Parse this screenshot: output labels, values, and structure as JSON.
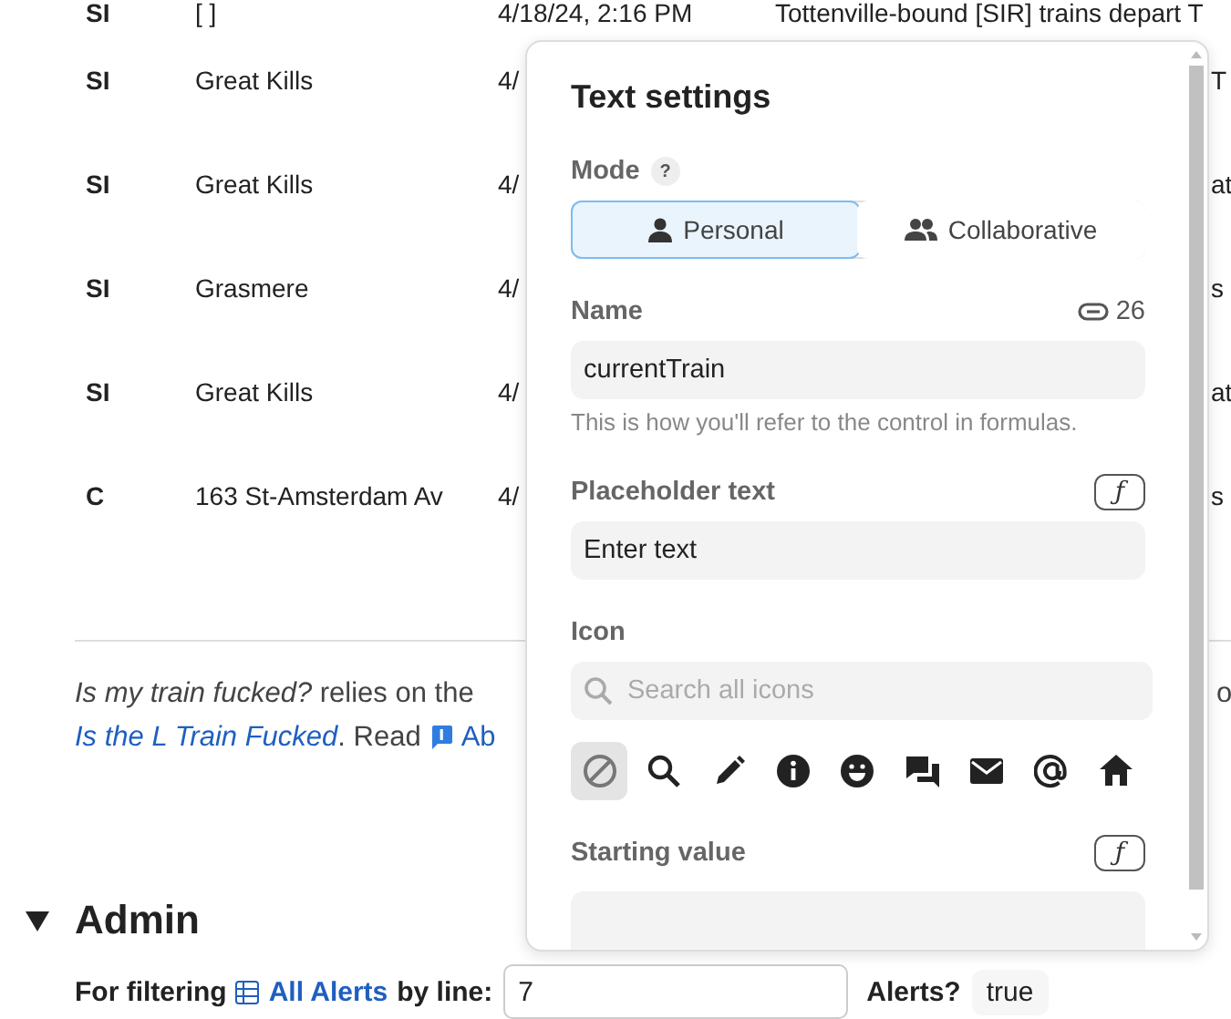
{
  "table": {
    "rows": [
      {
        "kind": "full",
        "line": "SI",
        "station": "[ ]",
        "date": "4/18/24, 2:16 PM",
        "message": "Tottenville-bound [SIR] trains depart T"
      },
      {
        "kind": "covered",
        "line": "SI",
        "station": "Great Kills",
        "date": "4/",
        "message": "T"
      },
      {
        "kind": "covered",
        "line": "SI",
        "station": "Great Kills",
        "date": "4/",
        "message": "at"
      },
      {
        "kind": "covered",
        "line": "SI",
        "station": "Grasmere",
        "date": "4/",
        "message": "s"
      },
      {
        "kind": "covered",
        "line": "SI",
        "station": "Great Kills",
        "date": "4/",
        "message": "at"
      },
      {
        "kind": "covered",
        "line": "C",
        "station": "163 St-Amsterdam Av",
        "date": "4/",
        "message": "s"
      }
    ]
  },
  "note": {
    "line_1": "*Is my train fucked?* relies on the",
    "line_1_tail": "o",
    "site_link": "Is the L Train Fucked",
    "read": ". Read",
    "about_link": "Ab"
  },
  "admin": {
    "expanded": true,
    "title": "Admin",
    "filter_label": "For filtering",
    "table_link": "All Alerts",
    "by_line": "by line:",
    "line_value": "7",
    "alerts_label": "Alerts?",
    "alerts_value": "true"
  },
  "panel": {
    "title": "Text settings",
    "mode": {
      "label": "Mode",
      "help": "?",
      "options": [
        {
          "label": "Personal",
          "selected": true
        },
        {
          "label": "Collaborative",
          "selected": false
        }
      ]
    },
    "name": {
      "label": "Name",
      "ref_count": "26",
      "value": "currentTrain",
      "hint": "This is how you'll refer to the control in formulas."
    },
    "placeholder_text": {
      "label": "Placeholder text",
      "formula": "ƒ",
      "value": "Enter text"
    },
    "icon": {
      "label": "Icon",
      "search_placeholder": "Search all icons",
      "icons": [
        {
          "selected": true
        },
        {
          "selected": false
        },
        {
          "selected": false
        },
        {
          "selected": false
        },
        {
          "selected": false
        },
        {
          "selected": false
        },
        {
          "selected": false
        },
        {
          "selected": false
        },
        {
          "selected": false
        }
      ]
    },
    "starting_value": {
      "label": "Starting value",
      "formula": "ƒ"
    }
  }
}
